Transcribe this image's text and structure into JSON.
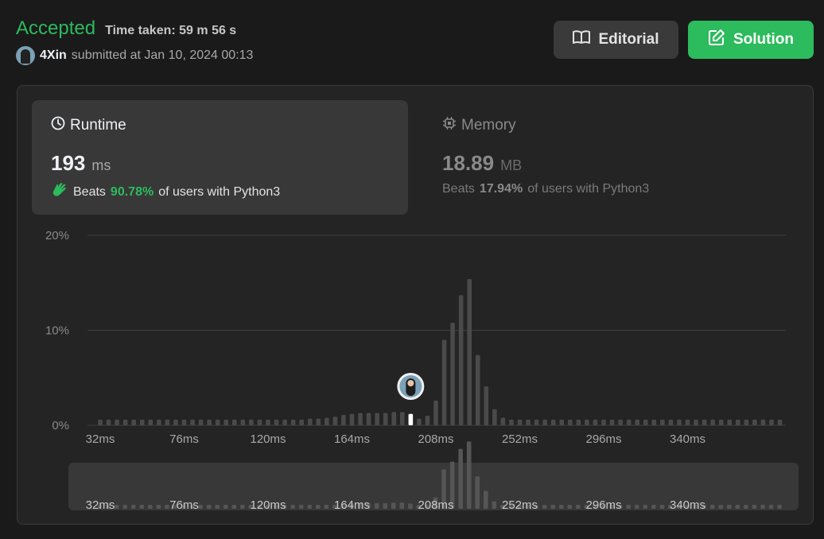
{
  "header": {
    "status": "Accepted",
    "time_taken": "Time taken: 59 m 56 s",
    "username": "4Xin",
    "submitted_at": "submitted at Jan 10, 2024 00:13"
  },
  "buttons": {
    "editorial_label": "Editorial",
    "solution_label": "Solution"
  },
  "runtime": {
    "title": "Runtime",
    "value": "193",
    "unit": "ms",
    "beats_prefix": "Beats",
    "beats_pct": "90.78%",
    "beats_suffix": "of users with Python3"
  },
  "memory": {
    "title": "Memory",
    "value": "18.89",
    "unit": "MB",
    "beats_prefix": "Beats",
    "beats_pct": "17.94%",
    "beats_suffix": "of users with Python3"
  },
  "colors": {
    "accent_green": "#2cbb5d",
    "bar": "#4a4a4a",
    "bar_selected": "#ffffff"
  },
  "icons": [
    "clock-icon",
    "chip-icon",
    "book-icon",
    "edit-icon",
    "clap-icon"
  ],
  "chart_data": {
    "type": "bar",
    "ylabel_ticks": [
      "20%",
      "10%",
      "0%"
    ],
    "ylim": [
      0,
      20
    ],
    "x_tick_labels": [
      "32ms",
      "76ms",
      "120ms",
      "164ms",
      "208ms",
      "252ms",
      "296ms",
      "340ms"
    ],
    "x_start_ms": 32,
    "x_step_ms": 4.4,
    "selected_ms": 193,
    "values": [
      0.6,
      0.6,
      0.6,
      0.6,
      0.6,
      0.6,
      0.6,
      0.6,
      0.6,
      0.6,
      0.6,
      0.6,
      0.6,
      0.6,
      0.6,
      0.6,
      0.6,
      0.6,
      0.6,
      0.6,
      0.6,
      0.6,
      0.6,
      0.6,
      0.6,
      0.7,
      0.7,
      0.8,
      0.9,
      1.1,
      1.2,
      1.3,
      1.3,
      1.3,
      1.3,
      1.4,
      1.4,
      1.2,
      0.7,
      1.0,
      2.6,
      9.0,
      10.8,
      13.7,
      15.4,
      7.4,
      4.1,
      1.7,
      0.8,
      0.6,
      0.6,
      0.6,
      0.6,
      0.6,
      0.6,
      0.6,
      0.6,
      0.6,
      0.6,
      0.6,
      0.6,
      0.6,
      0.6,
      0.6,
      0.6,
      0.6,
      0.6,
      0.6,
      0.6,
      0.6,
      0.6,
      0.6,
      0.6,
      0.6,
      0.6,
      0.6,
      0.6,
      0.6,
      0.6,
      0.6,
      0.6,
      0.6
    ]
  }
}
